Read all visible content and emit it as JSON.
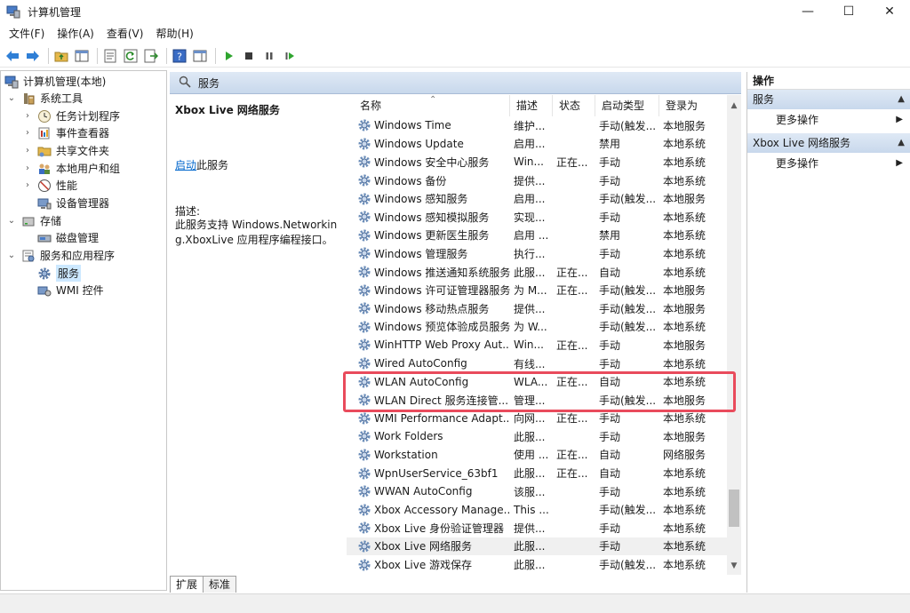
{
  "window": {
    "title": "计算机管理",
    "controls": {
      "minimize": "—",
      "maximize": "☐",
      "close": "✕"
    }
  },
  "menu": [
    "文件(F)",
    "操作(A)",
    "查看(V)",
    "帮助(H)"
  ],
  "tree": {
    "root": "计算机管理(本地)",
    "system_tools": "系统工具",
    "task_scheduler": "任务计划程序",
    "event_viewer": "事件查看器",
    "shared_folders": "共享文件夹",
    "local_users": "本地用户和组",
    "performance": "性能",
    "device_manager": "设备管理器",
    "storage": "存储",
    "disk_management": "磁盘管理",
    "services_apps": "服务和应用程序",
    "services": "服务",
    "wmi": "WMI 控件"
  },
  "services_header": "服务",
  "description": {
    "title": "Xbox Live 网络服务",
    "start_link": "启动",
    "start_suffix": "此服务",
    "label": "描述:",
    "text": "此服务支持 Windows.Networking.XboxLive 应用程序编程接口。"
  },
  "columns": {
    "name": "名称",
    "desc": "描述",
    "state": "状态",
    "startup": "启动类型",
    "logon": "登录为"
  },
  "rows": [
    {
      "name": "Windows Time",
      "desc": "维护...",
      "state": "",
      "startup": "手动(触发...",
      "logon": "本地服务"
    },
    {
      "name": "Windows Update",
      "desc": "启用...",
      "state": "",
      "startup": "禁用",
      "logon": "本地系统"
    },
    {
      "name": "Windows 安全中心服务",
      "desc": "Win...",
      "state": "正在...",
      "startup": "手动",
      "logon": "本地系统"
    },
    {
      "name": "Windows 备份",
      "desc": "提供...",
      "state": "",
      "startup": "手动",
      "logon": "本地系统"
    },
    {
      "name": "Windows 感知服务",
      "desc": "启用...",
      "state": "",
      "startup": "手动(触发...",
      "logon": "本地服务"
    },
    {
      "name": "Windows 感知模拟服务",
      "desc": "实现...",
      "state": "",
      "startup": "手动",
      "logon": "本地系统"
    },
    {
      "name": "Windows 更新医生服务",
      "desc": "启用 ...",
      "state": "",
      "startup": "禁用",
      "logon": "本地系统"
    },
    {
      "name": "Windows 管理服务",
      "desc": "执行...",
      "state": "",
      "startup": "手动",
      "logon": "本地系统"
    },
    {
      "name": "Windows 推送通知系统服务",
      "desc": "此服...",
      "state": "正在...",
      "startup": "自动",
      "logon": "本地系统"
    },
    {
      "name": "Windows 许可证管理器服务",
      "desc": "为 M...",
      "state": "正在...",
      "startup": "手动(触发...",
      "logon": "本地服务"
    },
    {
      "name": "Windows 移动热点服务",
      "desc": "提供...",
      "state": "",
      "startup": "手动(触发...",
      "logon": "本地服务"
    },
    {
      "name": "Windows 预览体验成员服务",
      "desc": "为 W...",
      "state": "",
      "startup": "手动(触发...",
      "logon": "本地系统"
    },
    {
      "name": "WinHTTP Web Proxy Aut...",
      "desc": "Win...",
      "state": "正在...",
      "startup": "手动",
      "logon": "本地服务"
    },
    {
      "name": "Wired AutoConfig",
      "desc": "有线...",
      "state": "",
      "startup": "手动",
      "logon": "本地系统"
    },
    {
      "name": "WLAN AutoConfig",
      "desc": "WLA...",
      "state": "正在...",
      "startup": "自动",
      "logon": "本地系统"
    },
    {
      "name": "WLAN Direct 服务连接管...",
      "desc": "管理...",
      "state": "",
      "startup": "手动(触发...",
      "logon": "本地服务"
    },
    {
      "name": "WMI Performance Adapt...",
      "desc": "向网...",
      "state": "正在...",
      "startup": "手动",
      "logon": "本地系统"
    },
    {
      "name": "Work Folders",
      "desc": "此服...",
      "state": "",
      "startup": "手动",
      "logon": "本地服务"
    },
    {
      "name": "Workstation",
      "desc": "使用 ...",
      "state": "正在...",
      "startup": "自动",
      "logon": "网络服务"
    },
    {
      "name": "WpnUserService_63bf1",
      "desc": "此服...",
      "state": "正在...",
      "startup": "自动",
      "logon": "本地系统"
    },
    {
      "name": "WWAN AutoConfig",
      "desc": "该服...",
      "state": "",
      "startup": "手动",
      "logon": "本地系统"
    },
    {
      "name": "Xbox Accessory Manage...",
      "desc": "This ...",
      "state": "",
      "startup": "手动(触发...",
      "logon": "本地系统"
    },
    {
      "name": "Xbox Live 身份验证管理器",
      "desc": "提供...",
      "state": "",
      "startup": "手动",
      "logon": "本地系统"
    },
    {
      "name": "Xbox Live 网络服务",
      "desc": "此服...",
      "state": "",
      "startup": "手动",
      "logon": "本地系统"
    },
    {
      "name": "Xbox Live 游戏保存",
      "desc": "此服...",
      "state": "",
      "startup": "手动(触发...",
      "logon": "本地系统"
    }
  ],
  "selected_row_index": 23,
  "tabs": [
    "扩展",
    "标准"
  ],
  "actions": {
    "title": "操作",
    "section1": "服务",
    "more1": "更多操作",
    "section2": "Xbox Live 网络服务",
    "more2": "更多操作"
  },
  "colors": {
    "highlight_box": "#e94b5c",
    "header_blue": "#c8d8ec",
    "link": "#0066cc"
  }
}
